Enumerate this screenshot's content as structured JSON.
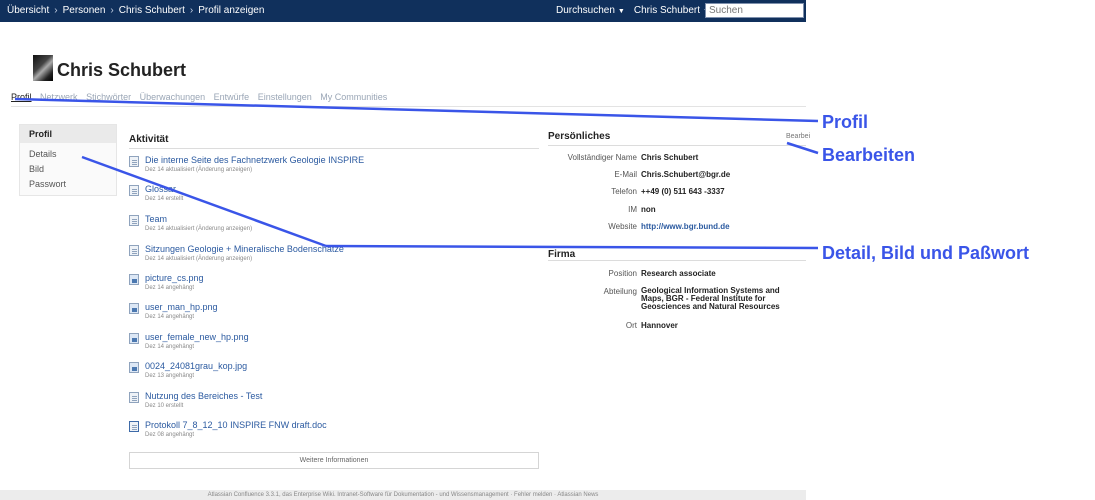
{
  "topbar": {
    "breadcrumbs": [
      "Übersicht",
      "Personen",
      "Chris Schubert",
      "Profil anzeigen"
    ],
    "browse_menu": "Durchsuchen",
    "user_menu": "Chris Schubert",
    "search_placeholder": "Suchen"
  },
  "profile": {
    "name": "Chris Schubert",
    "tabs": [
      "Profil",
      "Netzwerk",
      "Stichwörter",
      "Überwachungen",
      "Entwürfe",
      "Einstellungen",
      "My Communities"
    ]
  },
  "sidepanel": {
    "title": "Profil",
    "items": [
      "Details",
      "Bild",
      "Passwort"
    ]
  },
  "activity": {
    "title": "Aktivität",
    "items": [
      {
        "title": "Die interne Seite des Fachnetzwerk Geologie INSPIRE",
        "meta": "Dez 14 aktualisiert (Änderung anzeigen)",
        "icon": "page-icon"
      },
      {
        "title": "Glossar",
        "meta": "Dez 14 erstellt",
        "icon": "page-icon"
      },
      {
        "title": "Team",
        "meta": "Dez 14 aktualisiert (Änderung anzeigen)",
        "icon": "page-icon"
      },
      {
        "title": "Sitzungen Geologie + Mineralische Bodenschätze",
        "meta": "Dez 14 aktualisiert (Änderung anzeigen)",
        "icon": "page-icon"
      },
      {
        "title": "picture_cs.png",
        "meta": "Dez 14 angehängt",
        "icon": "image-icon"
      },
      {
        "title": "user_man_hp.png",
        "meta": "Dez 14 angehängt",
        "icon": "image-icon"
      },
      {
        "title": "user_female_new_hp.png",
        "meta": "Dez 14 angehängt",
        "icon": "image-icon"
      },
      {
        "title": "0024_24081grau_kop.jpg",
        "meta": "Dez 13 angehängt",
        "icon": "image-icon"
      },
      {
        "title": "Nutzung des Bereiches - Test",
        "meta": "Dez 10 erstellt",
        "icon": "page-icon"
      },
      {
        "title": "Protokoll 7_8_12_10 INSPIRE FNW draft.doc",
        "meta": "Dez 08 angehängt",
        "icon": "doc-icon"
      }
    ],
    "more_button": "Weitere Informationen"
  },
  "personal": {
    "title": "Persönliches",
    "edit_link": "Bearbei",
    "fields": [
      {
        "label": "Vollständiger Name",
        "value": "Chris Schubert"
      },
      {
        "label": "E-Mail",
        "value": "Chris.Schubert@bgr.de"
      },
      {
        "label": "Telefon",
        "value": "++49 (0) 511 643 -3337"
      },
      {
        "label": "IM",
        "value": "non"
      },
      {
        "label": "Website",
        "value": "http://www.bgr.bund.de"
      }
    ]
  },
  "company": {
    "title": "Firma",
    "fields": [
      {
        "label": "Position",
        "value": "Research associate"
      },
      {
        "label": "Abteilung",
        "value": "Geological Information Systems and Maps, BGR - Federal Institute for Geosciences and Natural Resources"
      },
      {
        "label": "Ort",
        "value": "Hannover"
      }
    ]
  },
  "footer": {
    "text": "Atlassian Confluence 3.3.1, das Enterprise Wiki. Intranet-Software für Dokumentation - und Wissensmanagement · Fehler melden · Atlassian News"
  },
  "annotations": {
    "profil": "Profil",
    "bearbeiten": "Bearbeiten",
    "detail": "Detail, Bild und Paßwort",
    "color": "#3a55e8"
  }
}
